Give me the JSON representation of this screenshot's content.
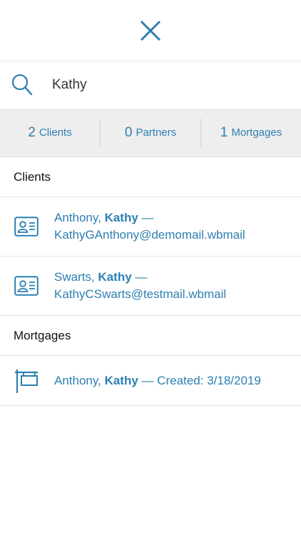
{
  "search": {
    "value": "Kathy"
  },
  "counts": [
    {
      "number": "2",
      "label": "Clients"
    },
    {
      "number": "0",
      "label": "Partners"
    },
    {
      "number": "1",
      "label": "Mortgages"
    }
  ],
  "sections": {
    "clients_title": "Clients",
    "mortgages_title": "Mortgages"
  },
  "clients": [
    {
      "last_name": "Anthony,",
      "first_name": "Kathy",
      "separator": "—",
      "email": "KathyGAnthony@demomail.wbmail"
    },
    {
      "last_name": "Swarts,",
      "first_name": "Kathy",
      "separator": "—",
      "email": "KathyCSwarts@testmail.wbmail"
    }
  ],
  "mortgages": [
    {
      "last_name": "Anthony,",
      "first_name": "Kathy",
      "detail": "— Created: 3/18/2019"
    }
  ],
  "icons": {
    "close": "close-icon",
    "search": "search-icon",
    "client": "contact-card-icon",
    "mortgage": "hanging-sign-icon"
  },
  "colors": {
    "accent": "#2d7fb1",
    "count_bar_bg": "#eeeeee"
  }
}
